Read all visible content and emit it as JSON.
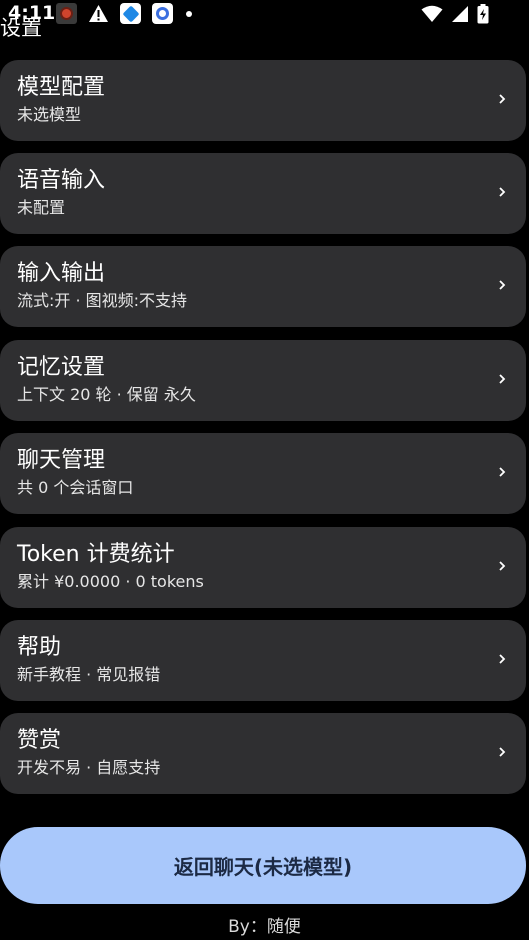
{
  "status_bar": {
    "time": "4:11",
    "icons": [
      "app-notification-icon",
      "warning-icon",
      "app-icon-blue-square",
      "app-icon-chat",
      "dot-icon"
    ],
    "right_icons": [
      "wifi-icon",
      "cellular-signal-icon",
      "battery-charging-icon"
    ]
  },
  "page": {
    "title": "设置"
  },
  "settings": {
    "items": [
      {
        "title": "模型配置",
        "subtitle": "未选模型"
      },
      {
        "title": "语音输入",
        "subtitle": "未配置"
      },
      {
        "title": "输入输出",
        "subtitle": "流式:开 · 图视频:不支持"
      },
      {
        "title": "记忆设置",
        "subtitle": "上下文 20 轮 · 保留 永久"
      },
      {
        "title": "聊天管理",
        "subtitle": "共 0 个会话窗口"
      },
      {
        "title": "Token 计费统计",
        "subtitle": "累计 ¥0.0000 · 0 tokens"
      },
      {
        "title": "帮助",
        "subtitle": "新手教程 · 常见报错"
      },
      {
        "title": "赞赏",
        "subtitle": "开发不易 · 自愿支持"
      }
    ]
  },
  "back_button": {
    "label": "返回聊天(未选模型)"
  },
  "footer": {
    "text": "By：随便"
  },
  "colors": {
    "background": "#000000",
    "card": "#2f2f31",
    "button": "#a9c8fb",
    "button_text": "#1c2a44"
  }
}
